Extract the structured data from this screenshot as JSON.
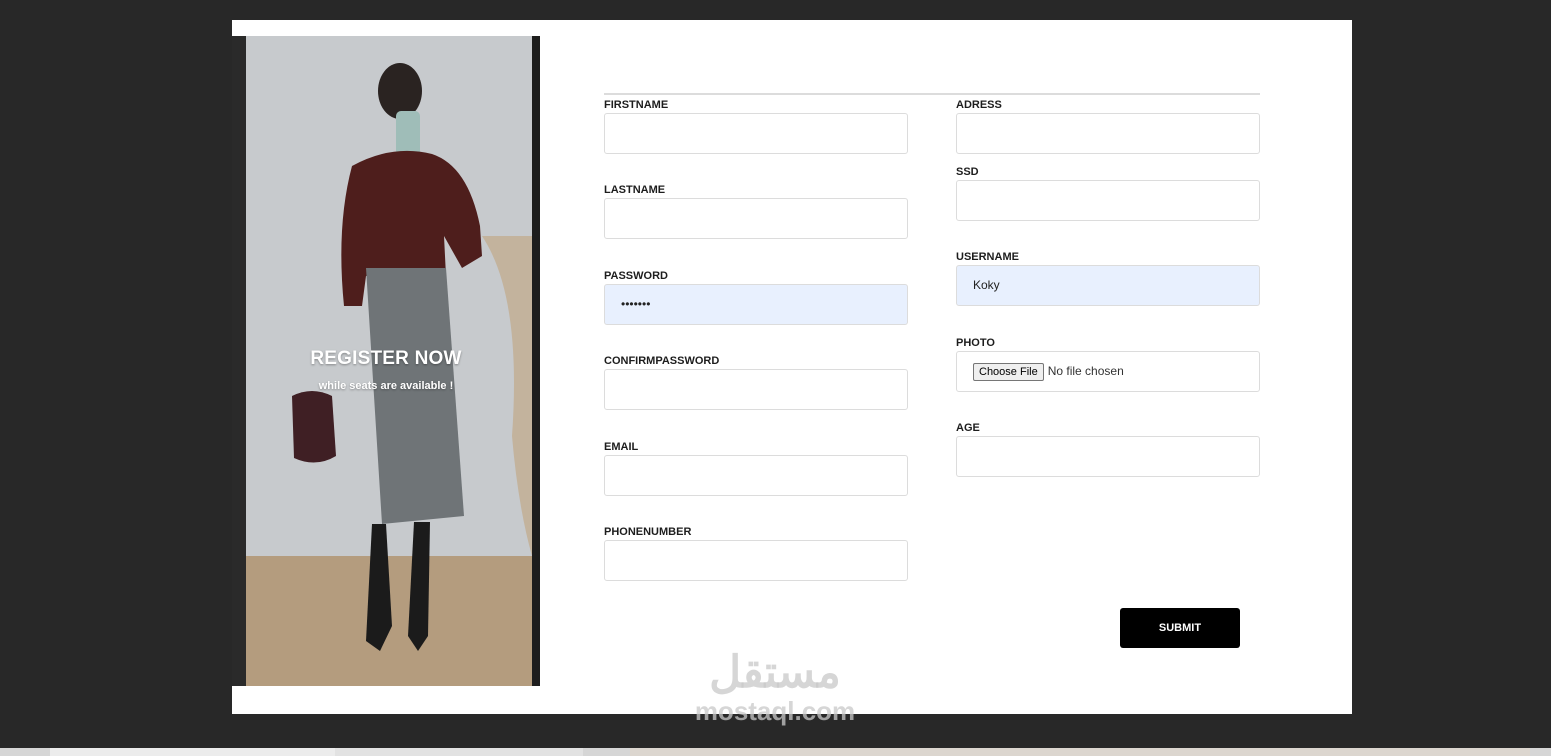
{
  "hero": {
    "title": "REGISTER NOW",
    "subtitle": "while seats are available !"
  },
  "form": {
    "left_fields": [
      {
        "label": "FIRSTNAME",
        "value": "",
        "type": "text"
      },
      {
        "label": "LASTNAME",
        "value": "",
        "type": "text"
      },
      {
        "label": "PASSWORD",
        "value": "•••••••",
        "type": "password"
      },
      {
        "label": "CONFIRMPASSWORD",
        "value": "",
        "type": "password"
      },
      {
        "label": "EMAIL",
        "value": "",
        "type": "email"
      },
      {
        "label": "PHONENUMBER",
        "value": "",
        "type": "text"
      }
    ],
    "right_fields": [
      {
        "label": "ADRESS",
        "value": ""
      },
      {
        "label": "SSD",
        "value": ""
      },
      {
        "label": "USERNAME",
        "value": "Koky"
      },
      {
        "label": "PHOTO",
        "file_button": "Choose File",
        "file_status": "No file chosen"
      },
      {
        "label": "AGE",
        "value": ""
      }
    ],
    "submit_label": "SUBMIT"
  },
  "watermark": {
    "arabic": "مستقل",
    "latin": "mostaql.com"
  },
  "colors": {
    "page_background": "#282828",
    "card_background": "#ffffff",
    "autofill_background": "#e8f0fe",
    "submit_background": "#000000"
  }
}
